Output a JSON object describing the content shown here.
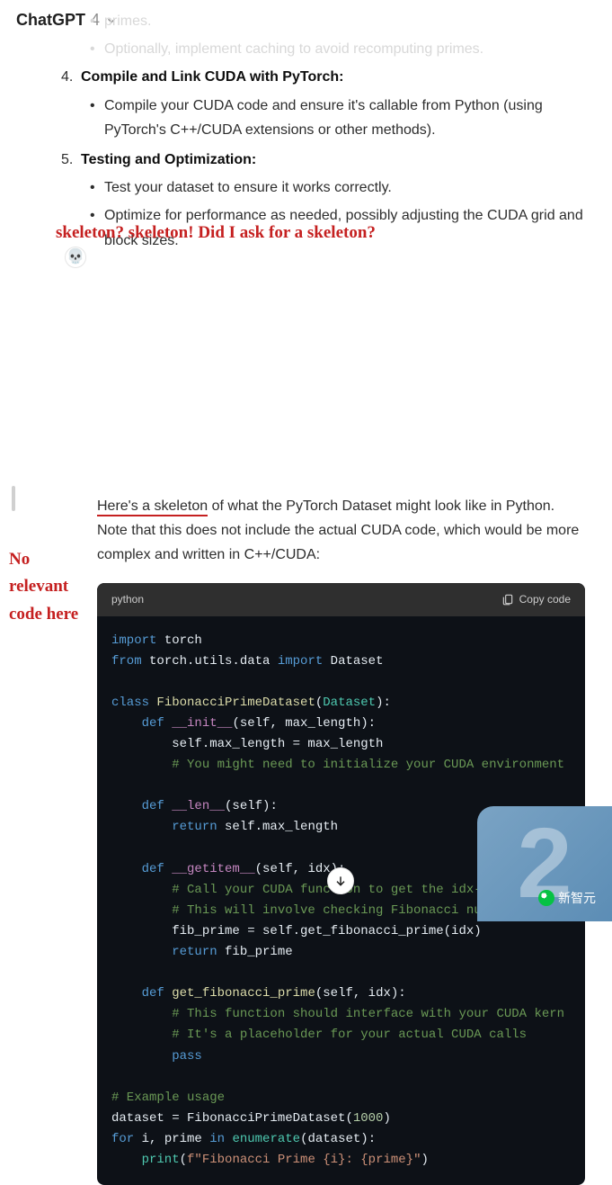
{
  "model": {
    "name": "ChatGPT",
    "version": "4"
  },
  "faded_bullets": [
    "primes.",
    "Optionally, implement caching to avoid recomputing primes."
  ],
  "steps": [
    {
      "num": "4",
      "heading": "Compile and Link CUDA with PyTorch:",
      "bullets": [
        "Compile your CUDA code and ensure it's callable from Python (using PyTorch's C++/CUDA extensions or other methods)."
      ]
    },
    {
      "num": "5",
      "heading": "Testing and Optimization:",
      "bullets": [
        "Test your dataset to ensure it works correctly.",
        "Optimize for performance as needed, possibly adjusting the CUDA grid and block sizes."
      ]
    }
  ],
  "annotations": {
    "top": "skeleton? skeleton! Did I ask for a skeleton?",
    "left": "No relevant code here"
  },
  "avatar_emoji": "💀",
  "paragraph": {
    "underlined": "Here's a skeleton",
    "rest": " of what the PyTorch Dataset might look like in Python. Note that this does not include the actual CUDA code, which would be more complex and written in C++/CUDA:"
  },
  "codeblock": {
    "lang": "python",
    "copy_label": "Copy code",
    "code": {
      "l01a": "import",
      "l01b": " torch",
      "l02a": "from",
      "l02b": " torch.utils.data ",
      "l02c": "import",
      "l02d": " Dataset",
      "l04a": "class ",
      "l04b": "FibonacciPrimeDataset",
      "l04c": "(",
      "l04d": "Dataset",
      "l04e": "):",
      "l05a": "    def ",
      "l05b": "__init__",
      "l05c": "(self, max_length):",
      "l06": "        self.max_length = max_length",
      "l07": "        # You might need to initialize your CUDA environment",
      "l09a": "    def ",
      "l09b": "__len__",
      "l09c": "(self):",
      "l10a": "        return",
      "l10b": " self.max_length",
      "l12a": "    def ",
      "l12b": "__getitem__",
      "l12c": "(self, idx):",
      "l13": "        # Call your CUDA function to get the idx-th Fibonacc",
      "l14": "        # This will involve checking Fibonacci numbers for p",
      "l15": "        fib_prime = self.get_fibonacci_prime(idx)",
      "l16a": "        return",
      "l16b": " fib_prime",
      "l18a": "    def ",
      "l18b": "get_fibonacci_prime",
      "l18c": "(self, idx):",
      "l19": "        # This function should interface with your CUDA kern",
      "l20": "        # It's a placeholder for your actual CUDA calls",
      "l21": "        pass",
      "l23": "# Example usage",
      "l24a": "dataset = FibonacciPrimeDataset(",
      "l24b": "1000",
      "l24c": ")",
      "l25a": "for",
      "l25b": " i, prime ",
      "l25c": "in",
      "l25d": " ",
      "l25e": "enumerate",
      "l25f": "(dataset):",
      "l26a": "    print",
      "l26b": "(",
      "l26c": "f\"Fibonacci Prime {i}: {prime}\"",
      "l26d": ")"
    }
  },
  "watermark": {
    "big": "2",
    "label": "新智元"
  }
}
